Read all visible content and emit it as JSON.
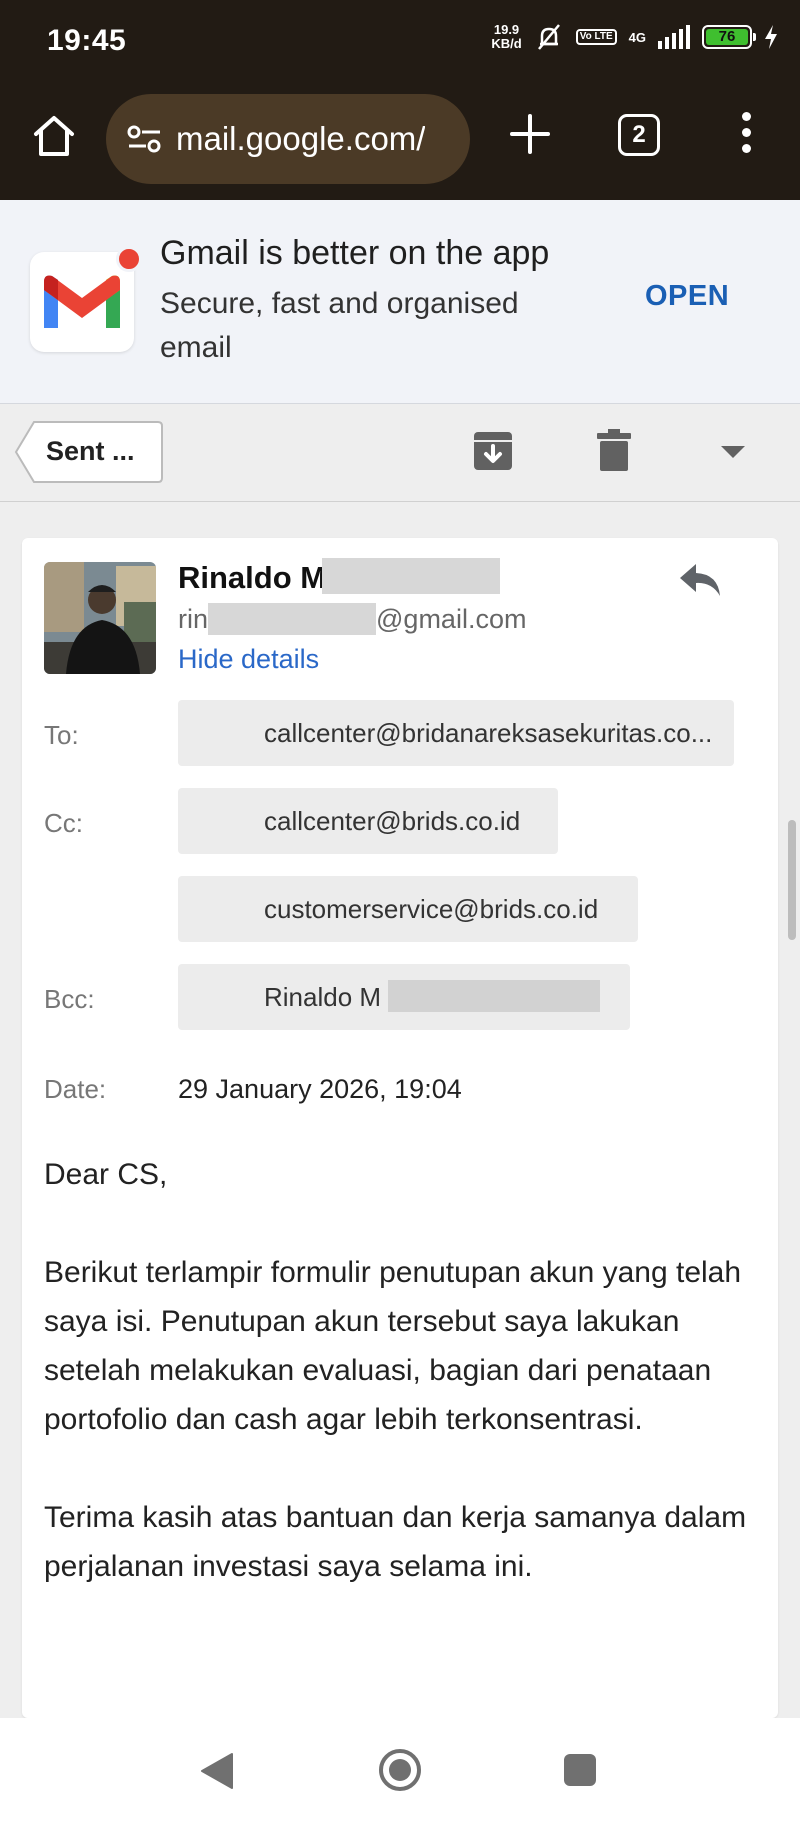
{
  "status_bar": {
    "time": "19:45",
    "net_speed_value": "19.9",
    "net_speed_unit": "KB/d",
    "volte_label": "Vo LTE",
    "network": "4G",
    "battery_level": "76"
  },
  "browser": {
    "url": "mail.google.com/",
    "tab_count": "2"
  },
  "promo": {
    "title": "Gmail is better on the app",
    "subtitle": "Secure, fast and organised email",
    "open_label": "OPEN"
  },
  "toolbar": {
    "back_label": "Sent ..."
  },
  "message": {
    "sender_name": "Rinaldo M",
    "sender_email_prefix": "rin",
    "sender_email_domain": "@gmail.com",
    "hide_details_label": "Hide details",
    "to_label": "To:",
    "to": [
      "callcenter@bridanareksasekuritas.co..."
    ],
    "cc_label": "Cc:",
    "cc": [
      "callcenter@brids.co.id",
      "customerservice@brids.co.id"
    ],
    "bcc_label": "Bcc:",
    "bcc": [
      "Rinaldo M"
    ],
    "date_label": "Date:",
    "date": "29 January 2026, 19:04",
    "body": [
      "Dear CS,",
      "Berikut terlampir formulir penutupan akun yang telah saya isi. Penutupan akun tersebut saya lakukan setelah melakukan evaluasi, bagian dari penataan portofolio dan cash agar lebih terkonsentrasi.",
      "Terima kasih atas bantuan dan kerja samanya dalam perjalanan investasi saya selama ini."
    ]
  },
  "colors": {
    "status_bg": "#221b14",
    "url_pill": "#4b3a26",
    "link_blue": "#2a68c8",
    "open_blue": "#1a5fb4",
    "battery_green": "#3fbf2f"
  }
}
